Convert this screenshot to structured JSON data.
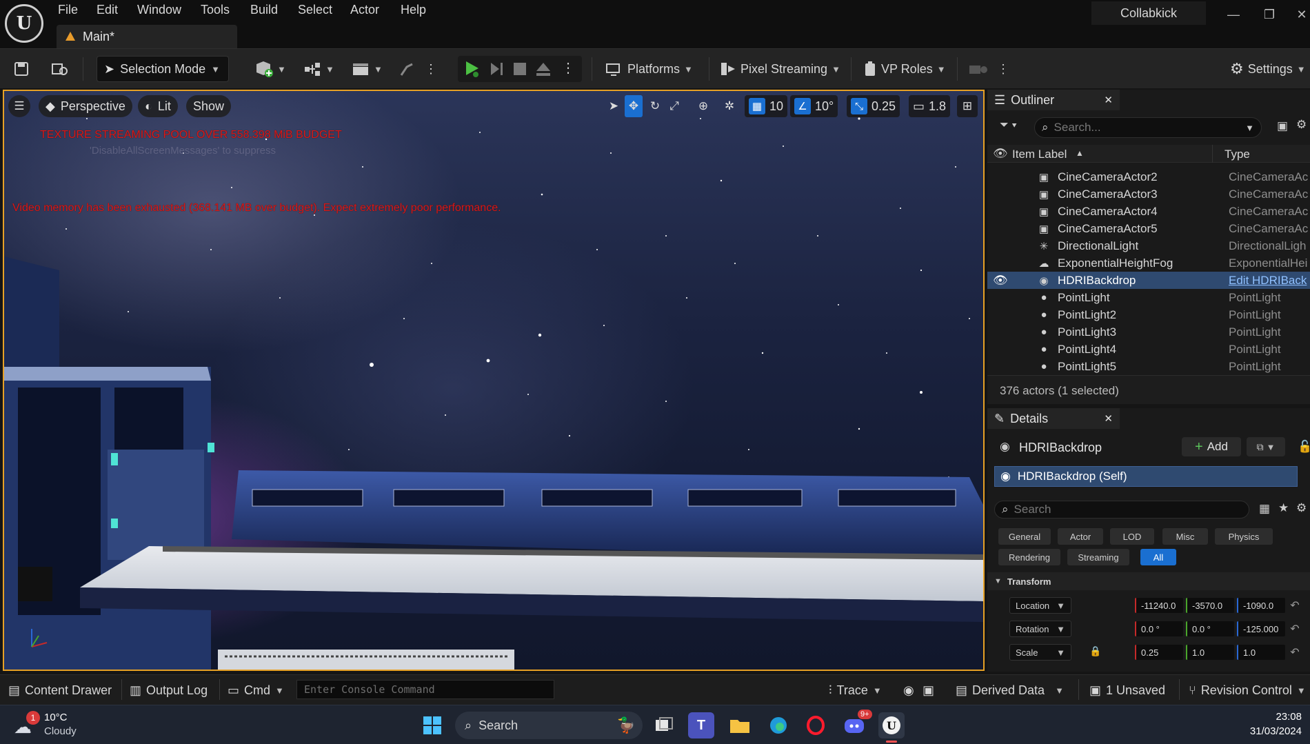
{
  "menu": {
    "items": [
      "File",
      "Edit",
      "Window",
      "Tools",
      "Build",
      "Select",
      "Actor",
      "Help"
    ],
    "doc_tab": "Main*",
    "project": "Collabkick"
  },
  "toolbar": {
    "selection_mode": "Selection Mode",
    "platforms": "Platforms",
    "pixel_streaming": "Pixel Streaming",
    "vp_roles": "VP Roles",
    "settings": "Settings"
  },
  "viewport": {
    "perspective": "Perspective",
    "lit": "Lit",
    "show": "Show",
    "grid_snap": "10",
    "rotation_snap": "10°",
    "scale_snap": "0.25",
    "camera_speed": "1.8",
    "warning_texture": "TEXTURE STREAMING POOL OVER 558.398 MiB BUDGET",
    "warning_texture_hint": "'DisableAllScreenMessages' to suppress",
    "warning_video_memory": "Video memory has been exhausted (368.141 MB over budget). Expect extremely poor performance."
  },
  "outliner": {
    "title": "Outliner",
    "search_placeholder": "Search...",
    "col_label": "Item Label",
    "col_type": "Type",
    "rows": [
      {
        "label": "CineCameraActor2",
        "type": "CineCameraAc",
        "icon": "camera-rig-icon"
      },
      {
        "label": "CineCameraActor3",
        "type": "CineCameraAc",
        "icon": "camera-rig-icon"
      },
      {
        "label": "CineCameraActor4",
        "type": "CineCameraAc",
        "icon": "camera-rig-icon"
      },
      {
        "label": "CineCameraActor5",
        "type": "CineCameraAc",
        "icon": "camera-rig-icon"
      },
      {
        "label": "DirectionalLight",
        "type": "DirectionalLigh",
        "icon": "sun-icon"
      },
      {
        "label": "ExponentialHeightFog",
        "type": "ExponentialHei",
        "icon": "fog-icon"
      },
      {
        "label": "HDRIBackdrop",
        "type": "Edit HDRIBack",
        "icon": "hdri-icon"
      },
      {
        "label": "PointLight",
        "type": "PointLight",
        "icon": "bulb-icon"
      },
      {
        "label": "PointLight2",
        "type": "PointLight",
        "icon": "bulb-icon"
      },
      {
        "label": "PointLight3",
        "type": "PointLight",
        "icon": "bulb-icon"
      },
      {
        "label": "PointLight4",
        "type": "PointLight",
        "icon": "bulb-icon"
      },
      {
        "label": "PointLight5",
        "type": "PointLight",
        "icon": "bulb-icon"
      }
    ],
    "footer": "376 actors (1 selected)"
  },
  "details": {
    "title": "Details",
    "actor_name": "HDRIBackdrop",
    "add_label": "Add",
    "component_self": "HDRIBackdrop (Self)",
    "search_placeholder": "Search",
    "filters_row1": [
      "General",
      "Actor",
      "LOD",
      "Misc",
      "Physics"
    ],
    "filters_row2": [
      "Rendering",
      "Streaming",
      "All"
    ],
    "transform_header": "Transform",
    "location_label": "Location",
    "rotation_label": "Rotation",
    "scale_label": "Scale",
    "location": [
      "-11240.0",
      "-3570.0",
      "-1090.0"
    ],
    "rotation": [
      "0.0 °",
      "0.0 °",
      "-125.000"
    ],
    "scale": [
      "0.25",
      "1.0",
      "1.0"
    ]
  },
  "statusbar": {
    "content_drawer": "Content Drawer",
    "output_log": "Output Log",
    "cmd": "Cmd",
    "console_placeholder": "Enter Console Command",
    "trace": "Trace",
    "derived_data": "Derived Data",
    "unsaved": "1 Unsaved",
    "revision_control": "Revision Control"
  },
  "taskbar": {
    "weather_temp": "10°C",
    "weather_desc": "Cloudy",
    "weather_badge": "1",
    "search": "Search",
    "discord_badge": "9+",
    "time": "23:08",
    "date": "31/03/2024"
  },
  "colors": {
    "accent": "#1a6fd1",
    "viewport_border": "#e7a125",
    "warning": "#d71a1a",
    "selection": "#2f4a70"
  }
}
